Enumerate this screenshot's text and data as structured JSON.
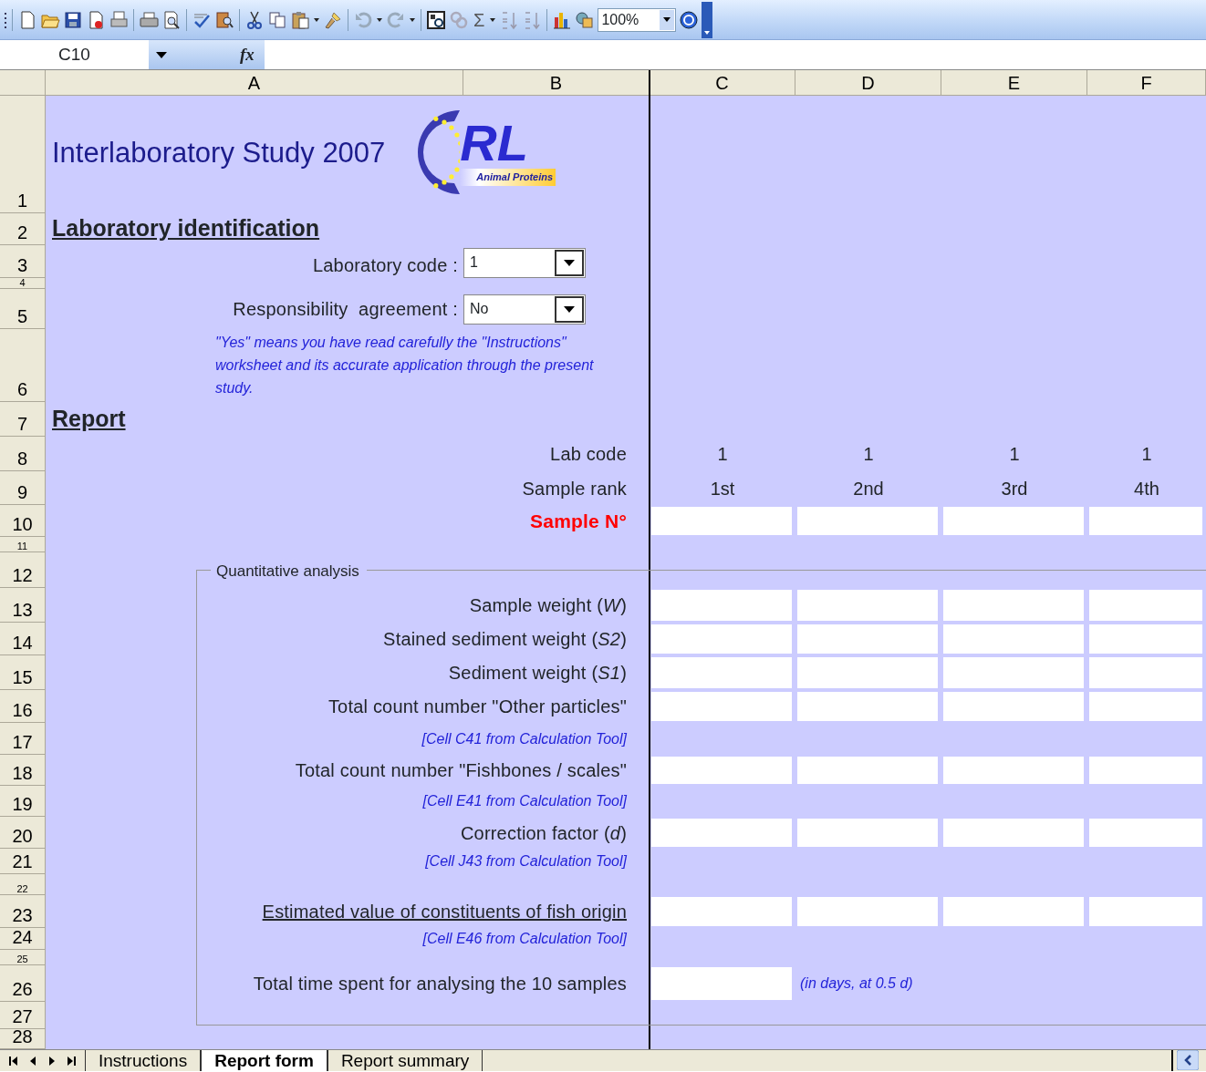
{
  "toolbar": {
    "zoom": "100%",
    "sum_symbol": "Σ"
  },
  "formula_bar": {
    "name_box": "C10",
    "fx_label": "fx"
  },
  "column_headers": [
    "A",
    "B",
    "C",
    "D",
    "E",
    "F"
  ],
  "row_headers": [
    "1",
    "2",
    "3",
    "4",
    "5",
    "6",
    "7",
    "8",
    "9",
    "10",
    "11",
    "12",
    "13",
    "14",
    "15",
    "16",
    "17",
    "18",
    "19",
    "20",
    "21",
    "22",
    "23",
    "24",
    "25",
    "26",
    "27",
    "28"
  ],
  "header": {
    "title": "Interlaboratory Study 2007",
    "logo": {
      "letters": "RL",
      "subtitle": "Animal Proteins"
    }
  },
  "identification": {
    "heading": "Laboratory identification",
    "fields": [
      {
        "label": "Laboratory code :",
        "value": "1"
      },
      {
        "label": "Responsibility  agreement :",
        "value": "No"
      }
    ],
    "note": "\"Yes\" means you have read carefully the \"Instructions\" worksheet and its accurate application through the present study."
  },
  "report": {
    "heading": "Report",
    "lab_code": {
      "label": "Lab code",
      "values": [
        "1",
        "1",
        "1",
        "1"
      ]
    },
    "sample_rank": {
      "label": "Sample rank",
      "values": [
        "1st",
        "2nd",
        "3rd",
        "4th"
      ]
    },
    "sample_no": {
      "label": "Sample N°"
    },
    "group_label": "Quantitative analysis",
    "items": [
      {
        "kind": "input",
        "label": "Sample weight (*W*)"
      },
      {
        "kind": "input",
        "label": "Stained sediment weight (*S2*)"
      },
      {
        "kind": "input",
        "label": "Sediment weight (*S1*)"
      },
      {
        "kind": "input",
        "label": "Total count number \"Other particles\""
      },
      {
        "kind": "note",
        "label": "[Cell C41 from Calculation Tool]"
      },
      {
        "kind": "input",
        "label": "Total count number \"Fishbones / scales\""
      },
      {
        "kind": "note",
        "label": "[Cell E41 from Calculation Tool]"
      },
      {
        "kind": "input",
        "label": "Correction factor (*d*)"
      },
      {
        "kind": "note",
        "label": "[Cell J43 from Calculation Tool]"
      },
      {
        "kind": "key_input",
        "label": "Estimated value of constituents of fish origin"
      },
      {
        "kind": "note",
        "label": "[Cell E46 from Calculation Tool]"
      },
      {
        "kind": "single_input",
        "label": "Total time spent for analysing the 10 samples",
        "unit_note": "(in days, at 0.5 d)"
      }
    ]
  },
  "sheet_tabs": [
    {
      "label": "Instructions",
      "selected": false
    },
    {
      "label": "Report form",
      "selected": true
    },
    {
      "label": "Report summary",
      "selected": false
    }
  ]
}
